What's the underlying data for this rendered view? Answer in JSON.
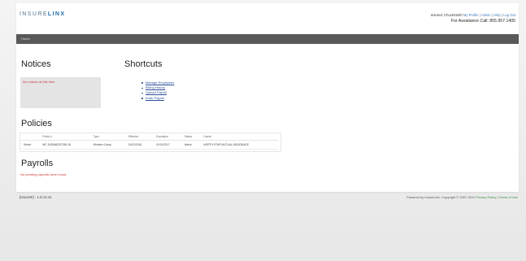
{
  "header": {
    "logo_left": "INSURE",
    "logo_right": "LINX",
    "greeting": "Insured: ChuckSmith",
    "links": [
      "My Profile",
      "Admin",
      "Help",
      "Log Out"
    ],
    "assistance": "For Assistance Call: 855.957.1405"
  },
  "nav": {
    "home": "Home"
  },
  "notices": {
    "title": "Notices",
    "message": "No notices at this time."
  },
  "shortcuts": {
    "title": "Shortcuts",
    "items": [
      "Manage Employees",
      "Billing History",
      "Upload Payroll",
      "Enter Payroll"
    ]
  },
  "policies": {
    "title": "Policies",
    "columns": [
      "",
      "Policy #",
      "Type",
      "Effective",
      "Expiration",
      "Status",
      "Carrier"
    ],
    "rows": [
      [
        "Select",
        "WC 1NSWADST090-16",
        "Workers Comp",
        "01/01/2016",
        "01/01/2017",
        "Active",
        "NORTH STAR MUTUAL INSURANCE"
      ]
    ]
  },
  "payrolls": {
    "title": "Payrolls",
    "message": "No pending payrolls were found."
  },
  "footer": {
    "version": "[InsureE] - 1.8.12.41",
    "powered": "Powered by InsureLinx. Copyright © 2007-2011",
    "links": [
      "Privacy Policy",
      "Terms of Use"
    ]
  },
  "colors": {
    "navbar": "#59595a",
    "notice_bg": "#e4e4e4",
    "alert_text": "#d03a3a",
    "link": "#2d4f9a",
    "footer_link": "#3f8a3f"
  }
}
